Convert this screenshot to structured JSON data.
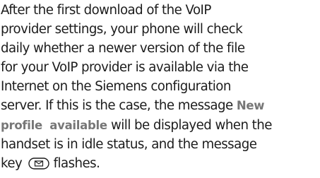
{
  "paragraph": {
    "line1": "After the first download of the VoIP",
    "line2": "provider settings, your phone will check",
    "line3": "daily whether a newer version of the file",
    "line4": "for your VoIP provider is available via the",
    "line5": "Internet on the Siemens configuration",
    "line6_pre": "server. If this is the case, the message ",
    "term_new": "New",
    "term_profile_available": "profile available",
    "line7_post": " will be displayed when the",
    "line8": "handset is in idle status, and the message",
    "line9_pre": "key ",
    "line9_post": " flashes.",
    "message_key_icon": "envelope-key-icon"
  }
}
